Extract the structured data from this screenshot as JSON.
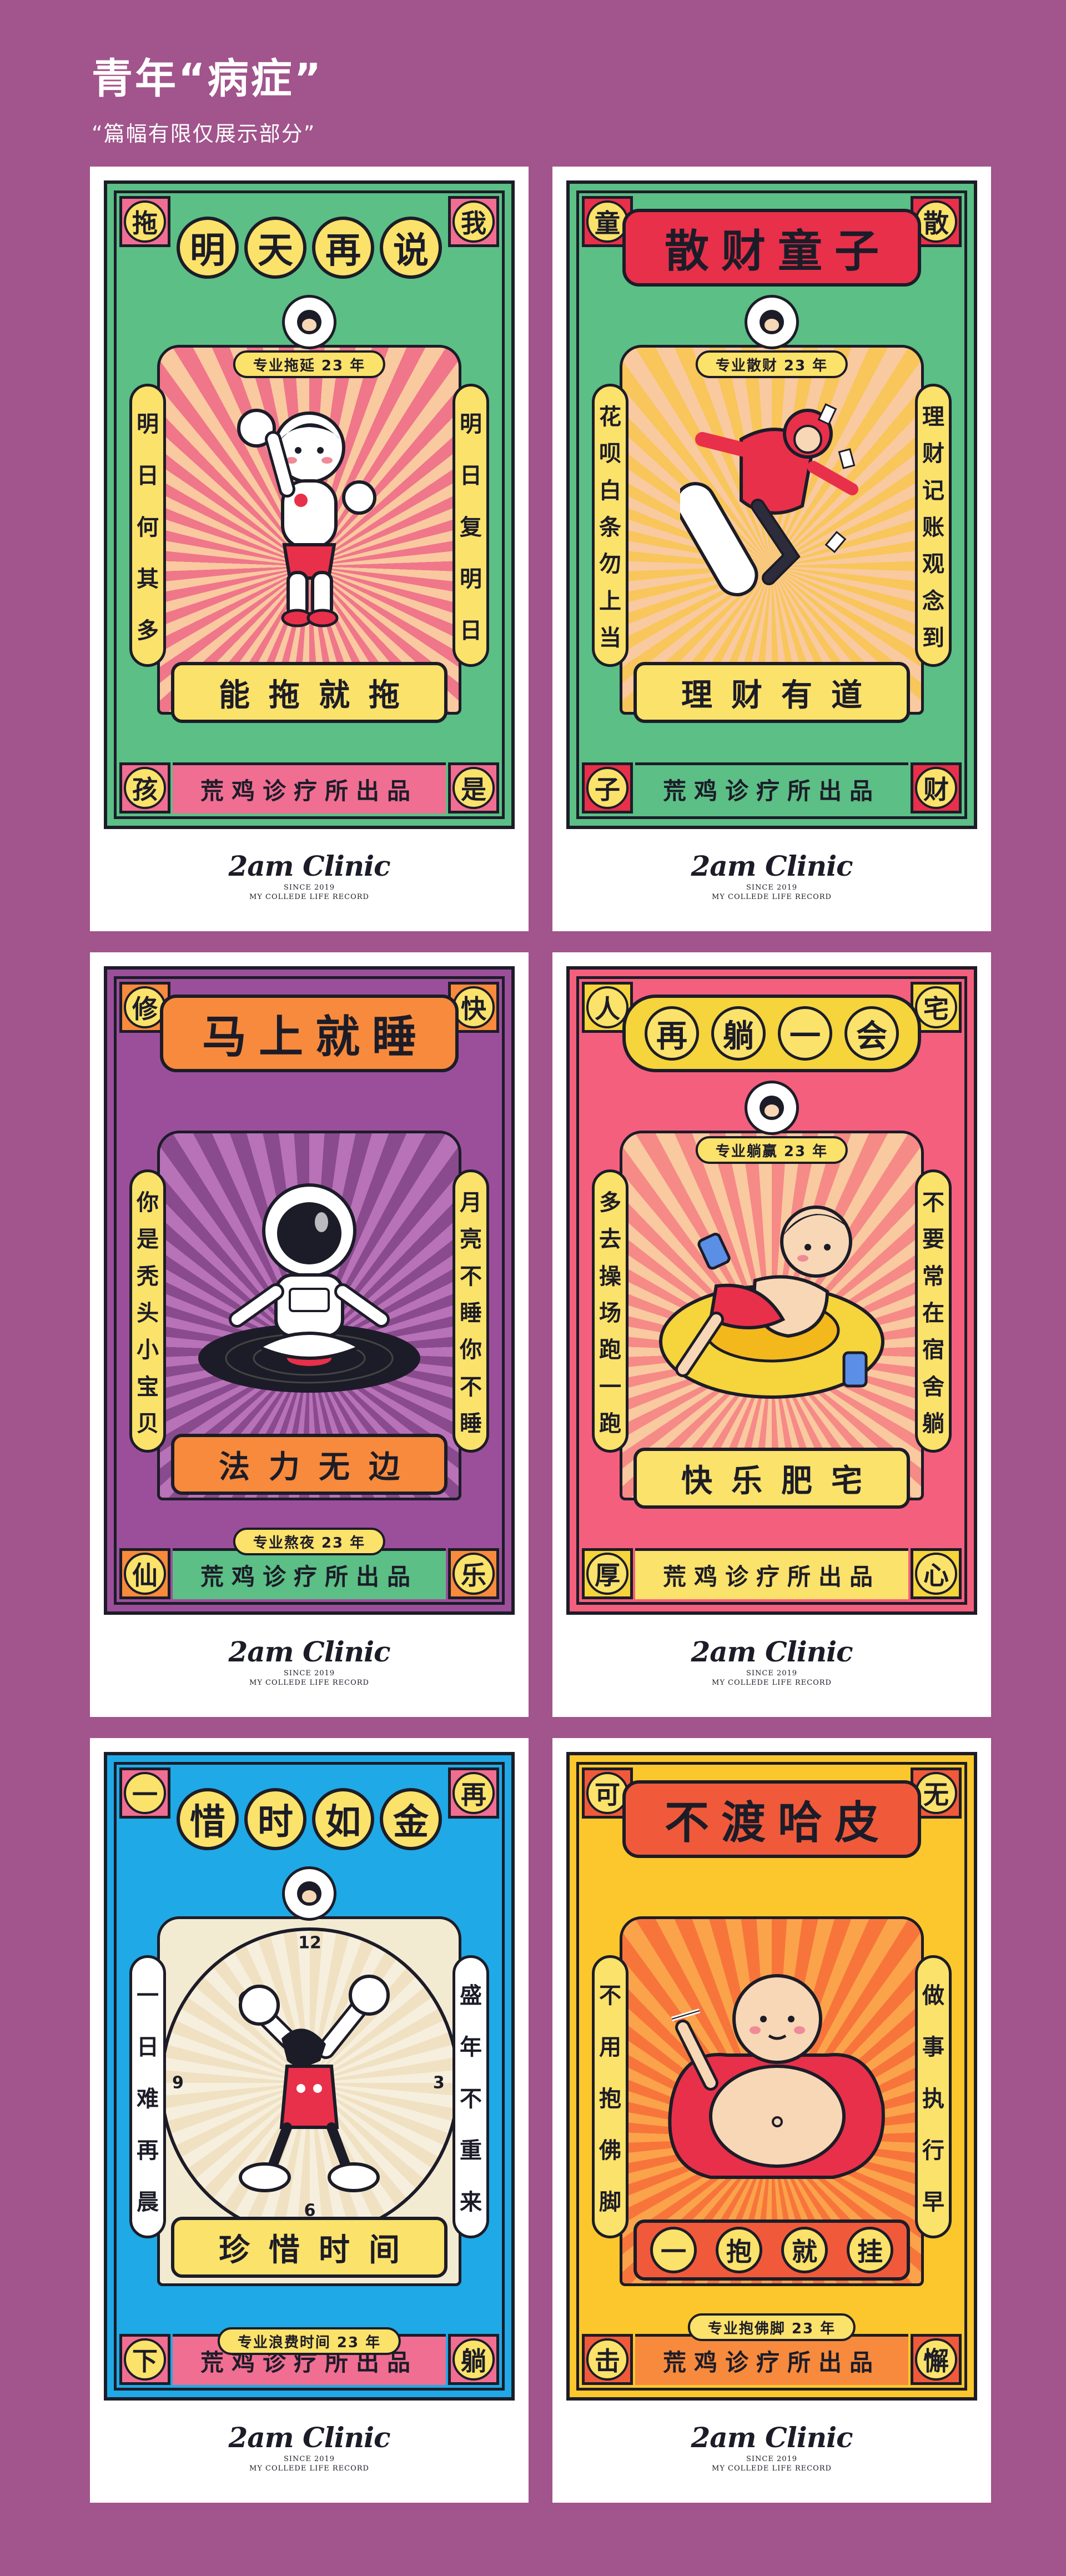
{
  "header": {
    "title": "青年“病症”",
    "subtitle": "“篇幅有限仅展示部分”"
  },
  "logo": {
    "brand": "2am Clinic",
    "since": "SINCE 2019",
    "record": "MY COLLEDE LIFE RECORD"
  },
  "posters": [
    {
      "bg": "#5bbf86",
      "ray": "#f0768a",
      "accent": "#f06e92",
      "corners": [
        "拖",
        "我",
        "孩",
        "是"
      ],
      "title": [
        "明",
        "天",
        "再",
        "说"
      ],
      "pro": "专业拖延 23 年",
      "left": [
        "明",
        "日",
        "何",
        "其",
        "多"
      ],
      "right": [
        "明",
        "日",
        "复",
        "明",
        "日"
      ],
      "scroll": [
        "能",
        "拖",
        "就",
        "拖"
      ],
      "footer": "荒鸡诊疗所出品"
    },
    {
      "bg": "#5bbf86",
      "ray": "#f8c65a",
      "accent": "#e8304a",
      "corners": [
        "童",
        "散",
        "子",
        "财"
      ],
      "title": [
        "散",
        "财",
        "童",
        "子"
      ],
      "pro": "专业散财 23 年",
      "left": [
        "花",
        "呗",
        "白",
        "条",
        "勿",
        "上",
        "当"
      ],
      "right": [
        "理",
        "财",
        "记",
        "账",
        "观",
        "念",
        "到"
      ],
      "scroll": [
        "理",
        "财",
        "有",
        "道"
      ],
      "footer": "荒鸡诊疗所出品"
    },
    {
      "bg": "#9b4f9a",
      "ray": "#a65aa6",
      "accent": "#f78a3c",
      "corners": [
        "修",
        "快",
        "仙",
        "乐"
      ],
      "title": [
        "马",
        "上",
        "就",
        "睡"
      ],
      "pro": "专业熬夜 23 年",
      "left": [
        "你",
        "是",
        "秃",
        "头",
        "小",
        "宝",
        "贝"
      ],
      "right": [
        "月",
        "亮",
        "不",
        "睡",
        "你",
        "不",
        "睡"
      ],
      "scroll": [
        "法",
        "力",
        "无",
        "边"
      ],
      "footer": "荒鸡诊疗所出品"
    },
    {
      "bg": "#f45f7e",
      "ray": "#f68a86",
      "accent": "#f5d43c",
      "corners": [
        "人",
        "宅",
        "厚",
        "心"
      ],
      "title": [
        "再",
        "躺",
        "一",
        "会"
      ],
      "pro": "专业躺赢 23 年",
      "left": [
        "多",
        "去",
        "操",
        "场",
        "跑",
        "一",
        "跑"
      ],
      "right": [
        "不",
        "要",
        "常",
        "在",
        "宿",
        "舍",
        "躺"
      ],
      "scroll": [
        "快",
        "乐",
        "肥",
        "宅"
      ],
      "footer": "荒鸡诊疗所出品"
    },
    {
      "bg": "#1fa9e6",
      "ray": "#5cc7ee",
      "accent": "#5bbf86",
      "corners": [
        "一",
        "再",
        "下",
        "躺"
      ],
      "title": [
        "惜",
        "时",
        "如",
        "金"
      ],
      "pro": "专业浪费时间 23 年",
      "left": [
        "一",
        "日",
        "难",
        "再",
        "晨"
      ],
      "right": [
        "盛",
        "年",
        "不",
        "重",
        "来"
      ],
      "scroll": [
        "珍",
        "惜",
        "时",
        "间"
      ],
      "clock": [
        "12",
        "3",
        "6",
        "9"
      ],
      "footer": "荒鸡诊疗所出品"
    },
    {
      "bg": "#fcc72c",
      "ray": "#f7753b",
      "accent": "#f05a3a",
      "corners": [
        "可",
        "无",
        "击",
        "懈"
      ],
      "title": [
        "不",
        "渡",
        "哈",
        "皮"
      ],
      "pro": "专业抱佛脚 23 年",
      "left": [
        "不",
        "用",
        "抱",
        "佛",
        "脚"
      ],
      "right": [
        "做",
        "事",
        "执",
        "行",
        "早"
      ],
      "scroll": [
        "一",
        "抱",
        "就",
        "挂"
      ],
      "footer": "荒鸡诊疗所出品"
    }
  ]
}
